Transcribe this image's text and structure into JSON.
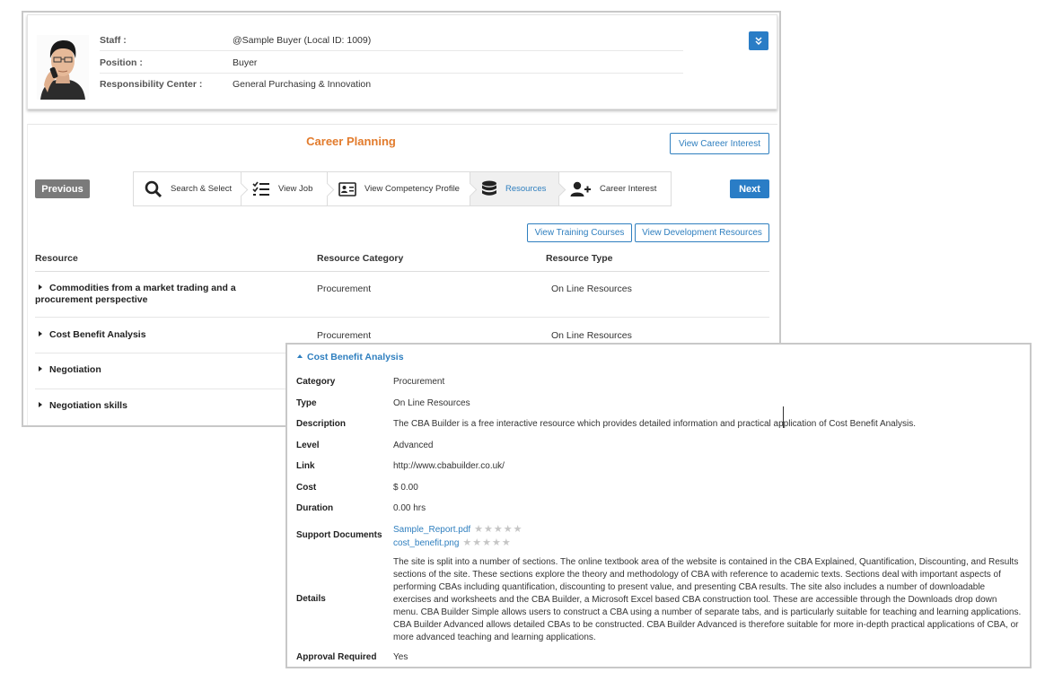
{
  "staff": {
    "staff_label": "Staff :",
    "staff_value": "@Sample Buyer (Local ID: 1009)",
    "position_label": "Position :",
    "position_value": "Buyer",
    "rc_label": "Responsibility Center :",
    "rc_value": "General Purchasing & Innovation"
  },
  "career": {
    "title": "Career Planning",
    "view_career_interest": "View Career Interest",
    "previous": "Previous",
    "next": "Next",
    "steps": [
      {
        "label": "Search & Select",
        "icon": "search-icon"
      },
      {
        "label": "View Job",
        "icon": "checklist-icon"
      },
      {
        "label": "View Competency Profile",
        "icon": "id-card-icon"
      },
      {
        "label": "Resources",
        "icon": "database-icon",
        "active": true
      },
      {
        "label": "Career Interest",
        "icon": "add-user-icon"
      }
    ],
    "view_training_courses": "View Training Courses",
    "view_development_resources": "View Development Resources"
  },
  "resources": {
    "columns": [
      "Resource",
      "Resource Category",
      "Resource Type"
    ],
    "rows": [
      {
        "name": "Commodities from a market trading and a procurement perspective",
        "category": "Procurement",
        "type": "On Line Resources"
      },
      {
        "name": "Cost Benefit Analysis",
        "category": "Procurement",
        "type": "On Line Resources"
      },
      {
        "name": "Negotiation",
        "category": "",
        "type": ""
      },
      {
        "name": "Negotiation skills",
        "category": "",
        "type": ""
      }
    ]
  },
  "detail": {
    "title": "Cost Benefit Analysis",
    "category_label": "Category",
    "category": "Procurement",
    "type_label": "Type",
    "type": "On Line Resources",
    "description_label": "Description",
    "description": "The CBA Builder is a free interactive resource which provides detailed information and practical application of Cost Benefit Analysis.",
    "level_label": "Level",
    "level": "Advanced",
    "link_label": "Link",
    "link": "http://www.cbabuilder.co.uk/",
    "cost_label": "Cost",
    "cost": "$ 0.00",
    "duration_label": "Duration",
    "duration": "0.00 hrs",
    "support_label": "Support Documents",
    "documents": [
      {
        "name": "Sample_Report.pdf",
        "rating": 0,
        "max": 5
      },
      {
        "name": "cost_benefit.png",
        "rating": 0,
        "max": 5
      }
    ],
    "details_label": "Details",
    "details": "The site is split into a number of sections. The online textbook area of the website is contained in the CBA Explained, Quantification, Discounting, and Results sections of the site. These sections explore the theory and methodology of CBA with reference to academic texts. Sections deal with important aspects of performing CBAs including quantification, discounting to present value, and presenting CBA results. The site also includes a number of downloadable exercises and worksheets and the CBA Builder, a Microsoft Excel based CBA construction tool. These are accessible through the Downloads drop down menu. CBA Builder Simple allows users to construct a CBA using a number of separate tabs, and is particularly suitable for teaching and learning applications. CBA Builder Advanced allows detailed CBAs to be constructed. CBA Builder Advanced is therefore suitable for more in-depth practical applications of CBA, or more advanced teaching and learning applications.",
    "approval_label": "Approval Required",
    "approval": "Yes"
  }
}
